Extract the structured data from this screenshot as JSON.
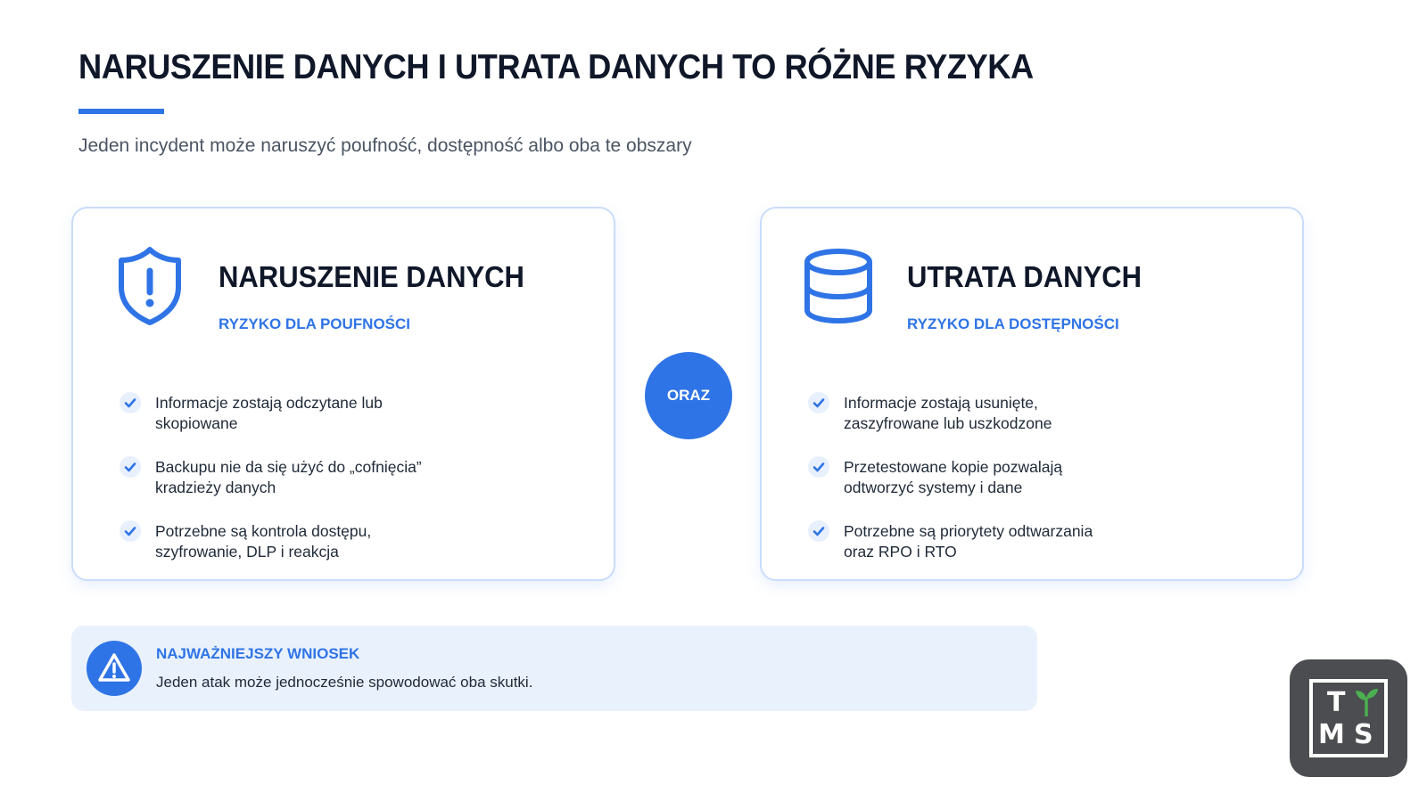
{
  "header": {
    "title": "NARUSZENIE DANYCH I UTRATA DANYCH TO RÓŻNE RYZYKA",
    "subtitle": "Jeden incydent może naruszyć poufność, dostępność albo oba te obszary"
  },
  "cards": [
    {
      "icon": "shield-alert-icon",
      "title": "NARUSZENIE DANYCH",
      "subtitle": "RYZYKO DLA POUFNOŚCI",
      "items": [
        "Informacje zostają odczytane lub skopiowane",
        "Backupu nie da się użyć do „cofnięcia” kradzieży danych",
        "Potrzebne są kontrola dostępu, szyfrowanie, DLP i reakcja"
      ]
    },
    {
      "icon": "database-icon",
      "title": "UTRATA DANYCH",
      "subtitle": "RYZYKO DLA DOSTĘPNOŚCI",
      "items": [
        "Informacje zostają usunięte, zaszyfrowane lub uszkodzone",
        "Przetestowane kopie pozwalają odtworzyć systemy i dane",
        "Potrzebne są priorytety odtwarzania oraz RPO i RTO"
      ]
    }
  ],
  "connector": {
    "label": "ORAZ"
  },
  "conclusion": {
    "icon": "warning-triangle-icon",
    "title": "NAJWAŻNIEJSZY WNIOSEK",
    "text": "Jeden atak może jednocześnie spowodować oba skutki."
  },
  "logo": {
    "letters": [
      "T",
      "M",
      "S"
    ],
    "icon": "sprout-icon"
  },
  "colors": {
    "accent": "#2f74e6",
    "title": "#0f1729",
    "conclusion_bg": "#e9f1fd",
    "logo_bg": "#4b4d50",
    "sprout": "#4caf50"
  }
}
